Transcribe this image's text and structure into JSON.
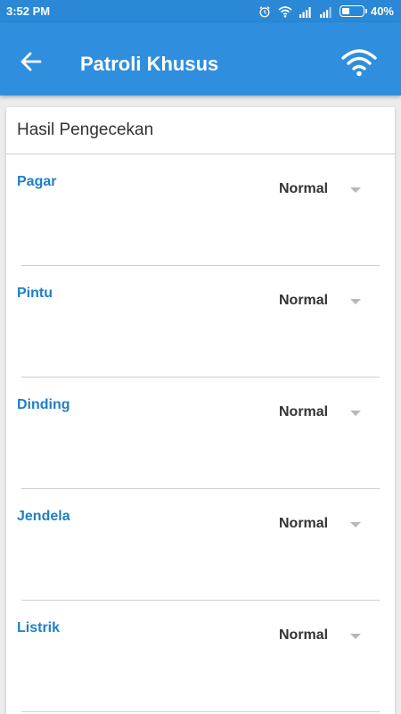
{
  "status_bar": {
    "time": "3:52 PM",
    "battery_pct": "40%",
    "battery_level": 0.4
  },
  "app_bar": {
    "title": "Patroli Khusus",
    "back_icon": "arrow-left-icon",
    "right_icon": "wifi-icon"
  },
  "card": {
    "header": "Hasil Pengecekan",
    "items": [
      {
        "label": "Pagar",
        "value": "Normal"
      },
      {
        "label": "Pintu",
        "value": "Normal"
      },
      {
        "label": "Dinding",
        "value": "Normal"
      },
      {
        "label": "Jendela",
        "value": "Normal"
      },
      {
        "label": "Listrik",
        "value": "Normal"
      }
    ]
  },
  "colors": {
    "status_bar": "#2a88d6",
    "app_bar": "#2f8fde",
    "label": "#1e7fc6",
    "background": "#ececec"
  }
}
